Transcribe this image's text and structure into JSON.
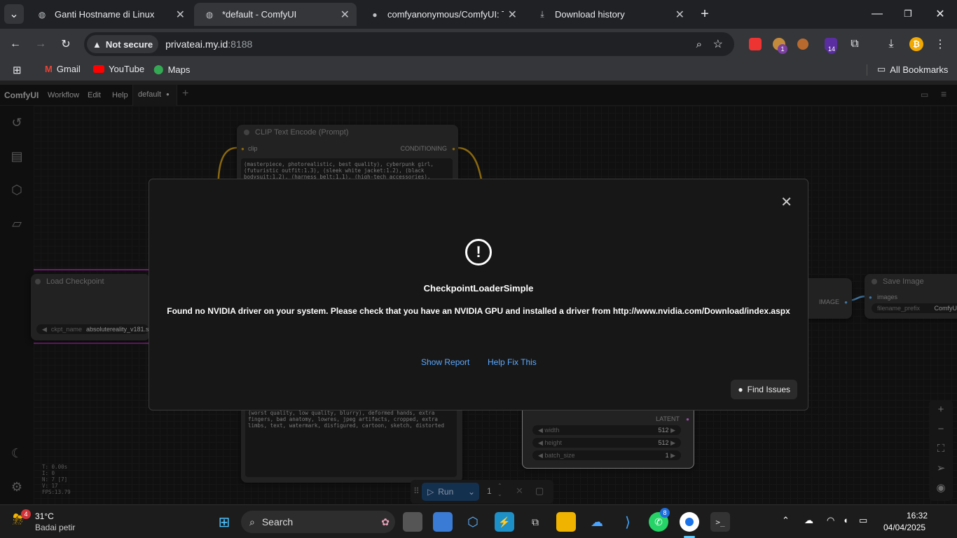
{
  "browser": {
    "tabs": [
      {
        "title": "Ganti Hostname di Linux",
        "active": false
      },
      {
        "title": "*default - ComfyUI",
        "active": true
      },
      {
        "title": "comfyanonymous/ComfyUI: The",
        "active": false
      },
      {
        "title": "Download history",
        "active": false
      }
    ],
    "security_label": "Not secure",
    "url_host": "privateai.my.id",
    "url_port": ":8188",
    "extension_badges": {
      "first": "1",
      "second": "14"
    },
    "bookmarks": [
      "Gmail",
      "YouTube",
      "Maps"
    ],
    "all_bookmarks": "All Bookmarks"
  },
  "comfy": {
    "logo": "ComfyUI",
    "menu": [
      "Workflow",
      "Edit",
      "Help"
    ],
    "workflow_tab": "default",
    "nodes": {
      "clip_title": "CLIP Text Encode (Prompt)",
      "clip_input": "clip",
      "clip_output": "CONDITIONING",
      "clip_text": "(masterpiece, photorealistic, best quality), cyberpunk girl, (futuristic outfit:1.3), (sleek white jacket:1.2), (black bodysuit:1.2), (harness belt:1.1), (high-tech accessories), silver-white hair, big breasts,",
      "checkpoint_title": "Load Checkpoint",
      "ckpt_label": "ckpt_name",
      "ckpt_value": "absolutereality_v181.sa",
      "save_title": "Save Image",
      "save_input": "images",
      "save_prefix_label": "filename_prefix",
      "save_prefix_value": "ComfyU",
      "image_output": "IMAGE",
      "negative_text": "(worst quality, low quality, blurry), deformed hands, extra fingers, bad anatomy, lowres, jpeg artifacts, cropped, extra limbs, text, watermark, disfigured, cartoon, sketch, distorted",
      "latent_output": "LATENT",
      "width_label": "width",
      "width_value": "512",
      "height_label": "height",
      "height_value": "512",
      "batch_label": "batch_size",
      "batch_value": "1"
    },
    "stats": [
      "T: 0.00s",
      "I: 0",
      "N: 7 [7]",
      "V: 17",
      "FPS:13.79"
    ],
    "run_label": "Run",
    "queue_count": "1"
  },
  "dialog": {
    "title": "CheckpointLoaderSimple",
    "message": "Found no NVIDIA driver on your system. Please check that you have an NVIDIA GPU and installed a driver from http://www.nvidia.com/Download/index.aspx",
    "show_report": "Show Report",
    "help_fix": "Help Fix This",
    "find_issues": "Find Issues"
  },
  "taskbar": {
    "weather_temp": "31°C",
    "weather_desc": "Badai petir",
    "weather_badge": "4",
    "search_label": "Search",
    "whatsapp_badge": "8",
    "time": "16:32",
    "date": "04/04/2025"
  }
}
